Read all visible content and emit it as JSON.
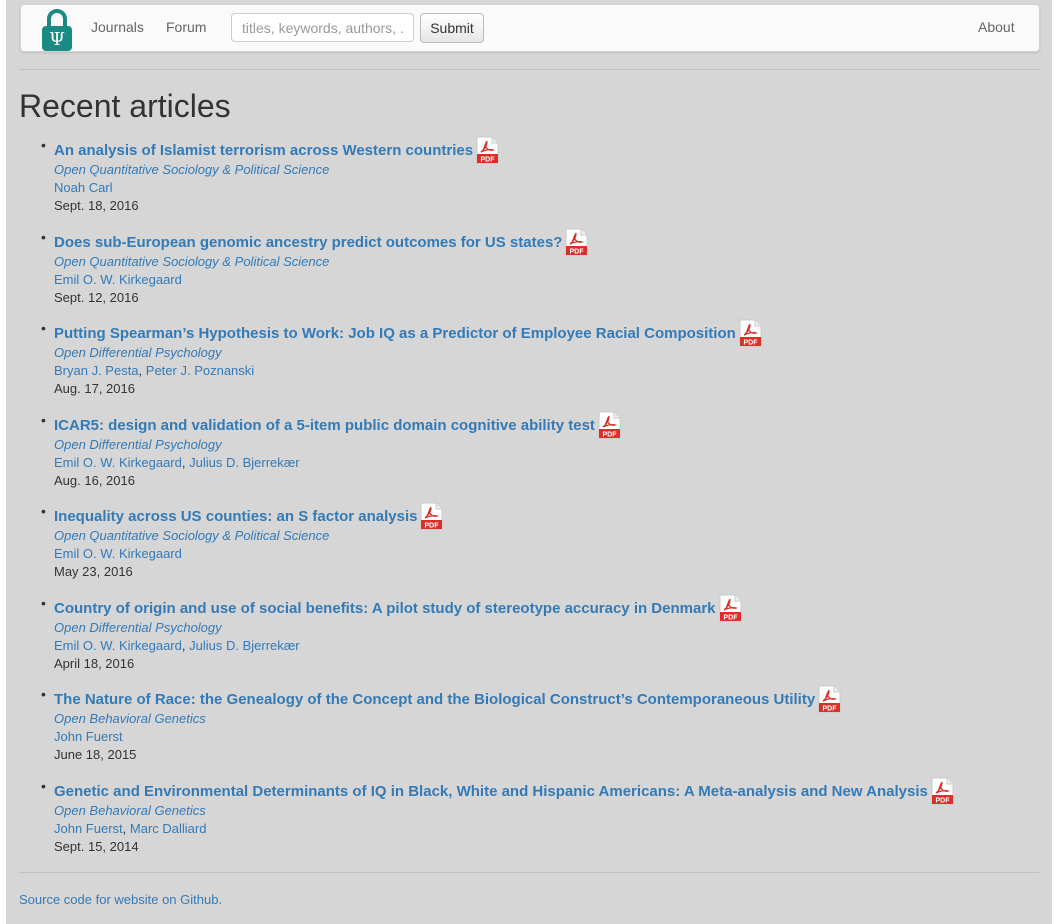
{
  "nav": {
    "journals": "Journals",
    "forum": "Forum",
    "search_placeholder": "titles, keywords, authors, ...",
    "search_value": "",
    "submit": "Submit",
    "about": "About",
    "logo_glyph": "Ψ",
    "logo_icon": "padlock-psi-logo-icon",
    "logo_color": "#1a8a85"
  },
  "page_title": "Recent articles",
  "pdf_icon": {
    "name": "pdf-icon",
    "label": "PDF",
    "color": "#d9302a"
  },
  "articles": [
    {
      "title": "An analysis of Islamist terrorism across Western countries",
      "journal": "Open Quantitative Sociology & Political Science",
      "authors": [
        "Noah Carl"
      ],
      "date": "Sept. 18, 2016"
    },
    {
      "title": "Does sub-European genomic ancestry predict outcomes for US states?",
      "journal": "Open Quantitative Sociology & Political Science",
      "authors": [
        "Emil O. W. Kirkegaard"
      ],
      "date": "Sept. 12, 2016"
    },
    {
      "title": "Putting Spearman’s Hypothesis to Work: Job IQ as a Predictor of Employee Racial Composition",
      "journal": "Open Differential Psychology",
      "authors": [
        "Bryan J. Pesta",
        "Peter J. Poznanski"
      ],
      "date": "Aug. 17, 2016"
    },
    {
      "title": "ICAR5: design and validation of a 5-item public domain cognitive ability test",
      "journal": "Open Differential Psychology",
      "authors": [
        "Emil O. W. Kirkegaard",
        "Julius D. Bjerrekær"
      ],
      "date": "Aug. 16, 2016"
    },
    {
      "title": "Inequality across US counties: an S factor analysis",
      "journal": "Open Quantitative Sociology & Political Science",
      "authors": [
        "Emil O. W. Kirkegaard"
      ],
      "date": "May 23, 2016"
    },
    {
      "title": "Country of origin and use of social benefits: A pilot study of stereotype accuracy in Denmark",
      "journal": "Open Differential Psychology",
      "authors": [
        "Emil O. W. Kirkegaard",
        "Julius D. Bjerrekær"
      ],
      "date": "April 18, 2016"
    },
    {
      "title": "The Nature of Race: the Genealogy of the Concept and the Biological Construct’s Contemporaneous Utility",
      "journal": "Open Behavioral Genetics",
      "authors": [
        "John Fuerst"
      ],
      "date": "June 18, 2015"
    },
    {
      "title": "Genetic and Environmental Determinants of IQ in Black, White and Hispanic Americans: A Meta-analysis and New Analysis",
      "journal": "Open Behavioral Genetics",
      "authors": [
        "John Fuerst",
        "Marc Dalliard"
      ],
      "date": "Sept. 15, 2014"
    }
  ],
  "footer": {
    "link": "Source code for website on Github."
  }
}
